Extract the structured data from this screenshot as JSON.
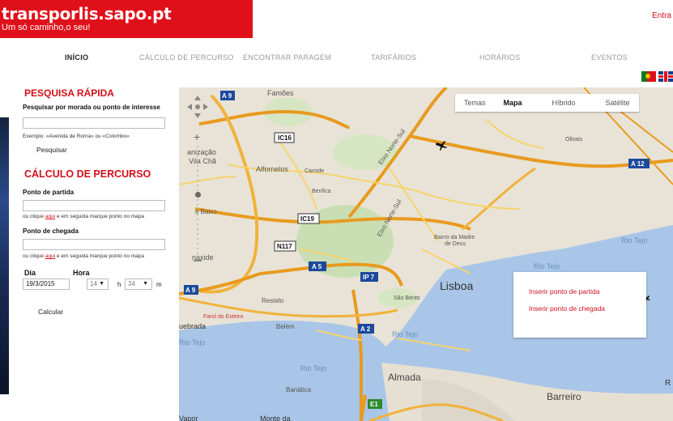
{
  "header": {
    "site_name": "transporlis.sapo.pt",
    "tagline": "Um só caminho,o seu!",
    "login_label": "Entra"
  },
  "nav": {
    "items": [
      "INÍCIO",
      "CÁLCULO DE PERCURSO",
      "ENCONTRAR PARAGEM",
      "TARIFÁRIOS",
      "HORÁRIOS",
      "EVENTOS"
    ]
  },
  "quick_search": {
    "title": "PESQUISA RÁPIDA",
    "label": "Pesquisar por morada ou ponto de interesse",
    "value": "",
    "example": "Exemplo: «Avenida de Roma» ou «Colombo»",
    "button": "Pesquisar"
  },
  "route": {
    "title": "CÁLCULO DE PERCURSO",
    "start_label": "Ponto de partida",
    "start_value": "",
    "end_label": "Ponto de chegada",
    "end_value": "",
    "hint_prefix": "ou clique",
    "hint_link": "aqui",
    "hint_suffix": "e em seguida marque ponto no mapa",
    "day_label": "Dia",
    "day_value": "19/3/2015",
    "hour_label": "Hora",
    "hour_value": "14",
    "hour_unit": "h",
    "minute_value": "34",
    "minute_unit": "m",
    "calc_button": "Calcular"
  },
  "map": {
    "types": [
      "Temas",
      "Mapa",
      "Híbrido",
      "Satélite"
    ],
    "selected_type": "Mapa",
    "context_menu": [
      "Inserir ponto de partida",
      "Inserir ponto de chegada"
    ],
    "places": {
      "lisboa": "Lisboa",
      "almada": "Almada",
      "barreiro": "Barreiro",
      "alfornelos": "Alfornelos",
      "benfica": "Benfica",
      "camide": "Camide",
      "olivais": "Olivais",
      "famoes": "Famões",
      "restelo": "Restelo",
      "belem": "Belém",
      "sao_bento": "São Bento",
      "banatica": "Banática",
      "rio_tejo": "Rio Tejo",
      "bairro_madre_1": "Bairro da Madre",
      "bairro_madre_2": "de Deus",
      "vila_cha_1": "anização",
      "vila_cha_2": "Vila Chã",
      "queluz_baixo": "e Baixo",
      "carnaxide": "naxide",
      "farol": "Farol do Esteiro",
      "quebrada": "uebrada",
      "vapor": "Vapor",
      "monte": "Monte da",
      "eixo_ns": "Eixo Norte-Sul",
      "r_right": "R"
    },
    "roads": [
      "IC16",
      "IC19",
      "N117",
      "A 5",
      "IP 7",
      "A 2",
      "A 9",
      "A 12",
      "E1"
    ]
  },
  "colors": {
    "brand_red": "#e0101a",
    "link_red": "#d2101a",
    "road_yellow": "#f7c94b",
    "road_orange": "#e89a1e",
    "water": "#a9c6e8"
  }
}
